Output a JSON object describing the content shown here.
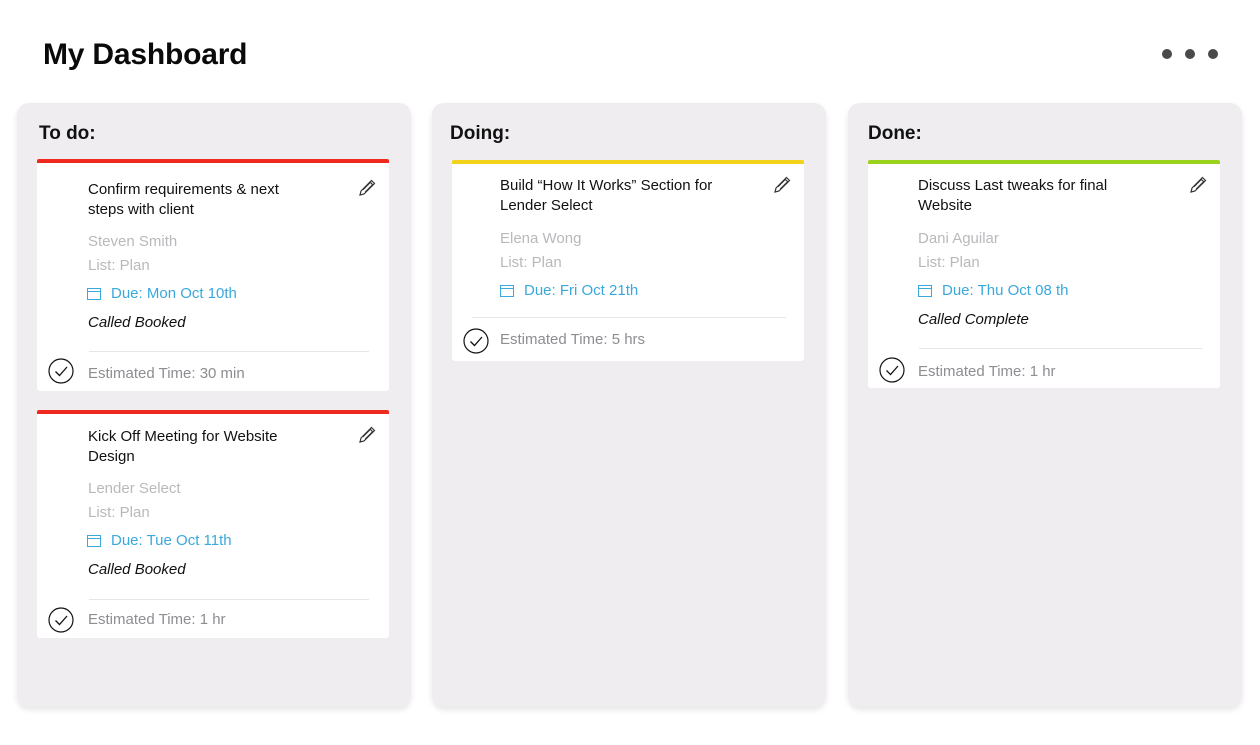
{
  "page": {
    "title": "My Dashboard",
    "more_icon": "more-horizontal-icon"
  },
  "colors": {
    "todo": "#f0291e",
    "doing": "#f2d11b",
    "done": "#9ad21e",
    "due": "#3aa8dd"
  },
  "columns": [
    {
      "title": "To do:",
      "cards": [
        {
          "title": "Confirm requirements & next steps with client",
          "person": "Steven Smith",
          "list": "List: Plan",
          "due": "Due: Mon Oct 10th",
          "status": "Called Booked",
          "estimate": "Estimated Time: 30 min"
        },
        {
          "title": "Kick Off Meeting for Website Design",
          "person": "Lender Select",
          "list": "List: Plan",
          "due": "Due: Tue Oct 11th",
          "status": "Called Booked",
          "estimate": "Estimated Time: 1 hr"
        }
      ]
    },
    {
      "title": "Doing:",
      "cards": [
        {
          "title": "Build “How It Works” Section for Lender Select",
          "person": "Elena Wong",
          "list": "List: Plan",
          "due": "Due: Fri Oct 21th",
          "estimate": "Estimated Time: 5 hrs"
        }
      ]
    },
    {
      "title": "Done:",
      "cards": [
        {
          "title": "Discuss Last tweaks for final Website",
          "person": "Dani Aguilar",
          "list": "List: Plan",
          "due": "Due: Thu Oct 08 th",
          "status": "Called Complete",
          "estimate": "Estimated Time: 1 hr"
        }
      ]
    }
  ],
  "icons": {
    "edit": "pencil-icon",
    "due": "calendar-icon",
    "complete": "check-circle-icon"
  }
}
